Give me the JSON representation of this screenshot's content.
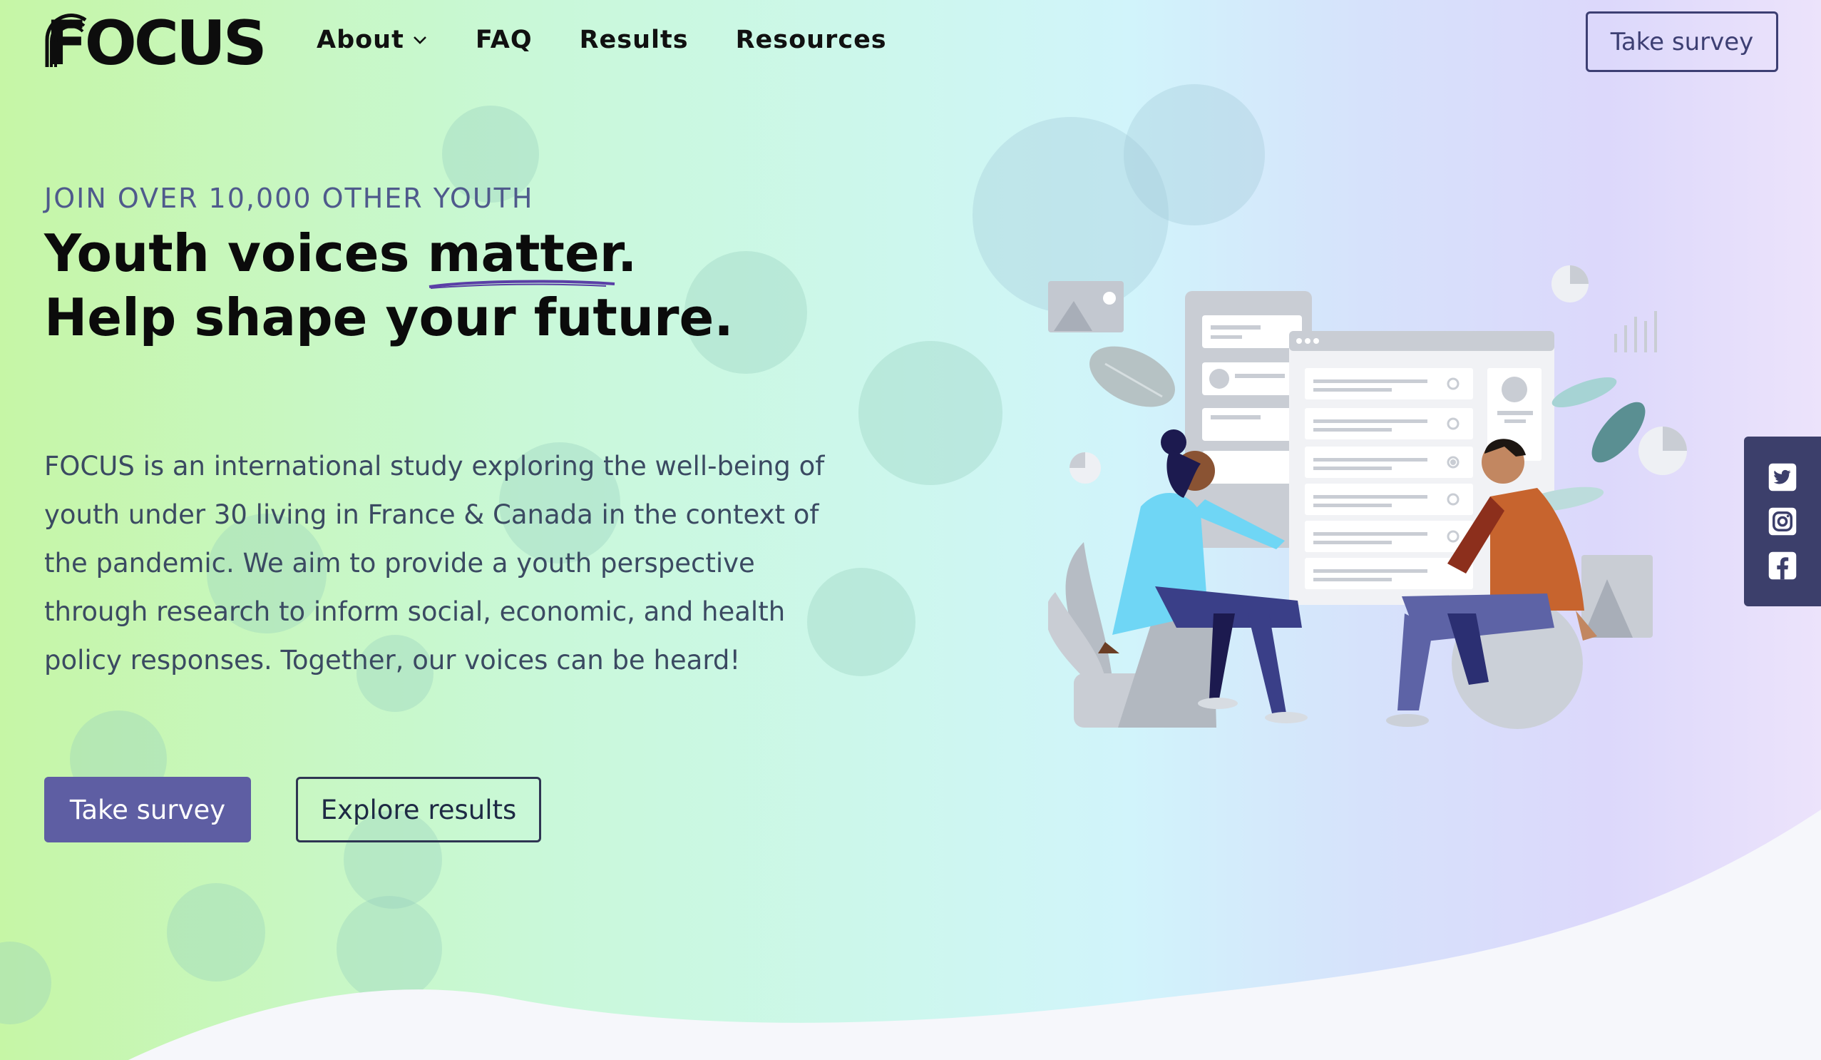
{
  "brand": {
    "logo_text": "FOCUS"
  },
  "nav": {
    "items": [
      {
        "label": "About",
        "has_dropdown": true
      },
      {
        "label": "FAQ"
      },
      {
        "label": "Results"
      },
      {
        "label": "Resources"
      }
    ],
    "cta_label": "Take survey"
  },
  "hero": {
    "eyebrow": "JOIN OVER 10,000 OTHER YOUTH",
    "headline_part1": "Youth voices ",
    "headline_emph": "matter.",
    "headline_line2": "Help shape your future.",
    "description": "FOCUS is an international study exploring the well-being of youth under 30 living in France & Canada in the context of the pandemic. We aim to provide a youth perspective through research to inform social, economic, and health policy responses. Together, our voices can be heard!",
    "primary_button": "Take survey",
    "secondary_button": "Explore results"
  },
  "social": {
    "items": [
      {
        "name": "twitter",
        "icon": "twitter-icon"
      },
      {
        "name": "instagram",
        "icon": "instagram-icon"
      },
      {
        "name": "facebook",
        "icon": "facebook-icon"
      }
    ]
  },
  "colors": {
    "primary": "#5e5ea3",
    "dark_navy": "#3c3f6b",
    "eyebrow": "#4f5a8c",
    "body_text": "#3b4a62"
  }
}
